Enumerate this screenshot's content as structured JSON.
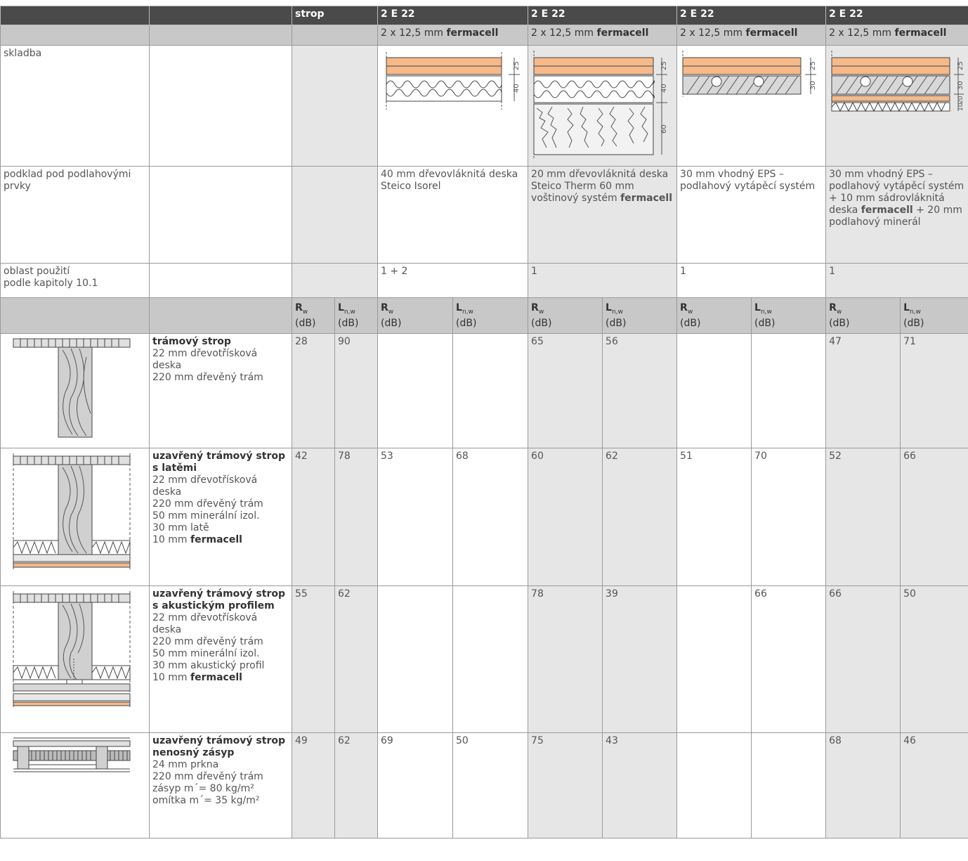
{
  "header": {
    "strop": "strop",
    "cols": [
      "2 E 22",
      "2 E 22",
      "2 E 22",
      "2 E 22"
    ],
    "sub_prefix": "2 x 12,5 mm",
    "sub_brand": "fermacell"
  },
  "rows": {
    "skladba": "skladba",
    "podklad_label": "podklad pod podlahovými prvky",
    "podklad": [
      {
        "text": "40 mm dřevovláknitá deska Steico Isorel",
        "bold": ""
      },
      {
        "text": "20 mm dřevovláknitá deska Steico Therm 60 mm voštinový systém",
        "bold": "fermacell"
      },
      {
        "text": "30 mm vhodný EPS – podlahový vytápěcí systém",
        "bold": ""
      },
      {
        "text": "30 mm vhodný EPS – podlahový vytápěcí systém + 10 mm sádrovláknitá deska",
        "bold": "fermacell",
        "tail": "+ 20 mm podlahový minerál"
      }
    ],
    "oblast_label_1": "oblast použití",
    "oblast_label_2": "podle kapitoly 10.1",
    "oblast": [
      "1 + 2",
      "1",
      "1",
      "1"
    ]
  },
  "dims": {
    "c1": [
      "25",
      "40"
    ],
    "c2": [
      "25",
      "40",
      "60"
    ],
    "c3": [
      "25",
      "30"
    ],
    "c4": [
      "25",
      "30",
      "20",
      "10"
    ]
  },
  "units": {
    "rw": "R",
    "rw_sub": "w",
    "ln": "L",
    "ln_sub": "n,w",
    "db": "(dB)"
  },
  "constructions": [
    {
      "title": "trámový strop",
      "lines": [
        "22 mm dřevotřísková deska",
        "220 mm dřevěný trám"
      ],
      "bold_last": "",
      "values": [
        "28",
        "90",
        "",
        "",
        "65",
        "56",
        "",
        "",
        "47",
        "71"
      ]
    },
    {
      "title": "uzavřený trámový strop s latěmi",
      "lines": [
        "22 mm dřevotřísková deska",
        "220 mm dřevěný trám",
        "50 mm minerální izol.",
        "30 mm latě"
      ],
      "bold_last_prefix": "10 mm",
      "bold_last": "fermacell",
      "values": [
        "42",
        "78",
        "53",
        "68",
        "60",
        "62",
        "51",
        "70",
        "52",
        "66"
      ]
    },
    {
      "title": "uzavřený trámový strop s akustickým profilem",
      "lines": [
        "22 mm dřevotřísková deska",
        "220 mm dřevěný trám",
        "50 mm minerální izol.",
        "30 mm akustický profil"
      ],
      "bold_last_prefix": "10 mm",
      "bold_last": "fermacell",
      "values": [
        "55",
        "62",
        "",
        "",
        "78",
        "39",
        "",
        "66",
        "66",
        "50"
      ]
    },
    {
      "title": "uzavřený trámový strop",
      "title2": "nenosný zásyp",
      "lines": [
        "24 mm prkna",
        "220 mm dřevěný trám",
        "zásyp m´= 80 kg/m²",
        "omítka m´= 35 kg/m²"
      ],
      "values": [
        "49",
        "62",
        "69",
        "50",
        "75",
        "43",
        "",
        "",
        "68",
        "46"
      ]
    }
  ],
  "colors": {
    "header_bg": "#4a4a4a",
    "subheader_bg": "#c8c8c8",
    "light_grey": "#e6e6e6",
    "board_orange": "#f5b98a",
    "beam_grey": "#c8c8c8"
  }
}
